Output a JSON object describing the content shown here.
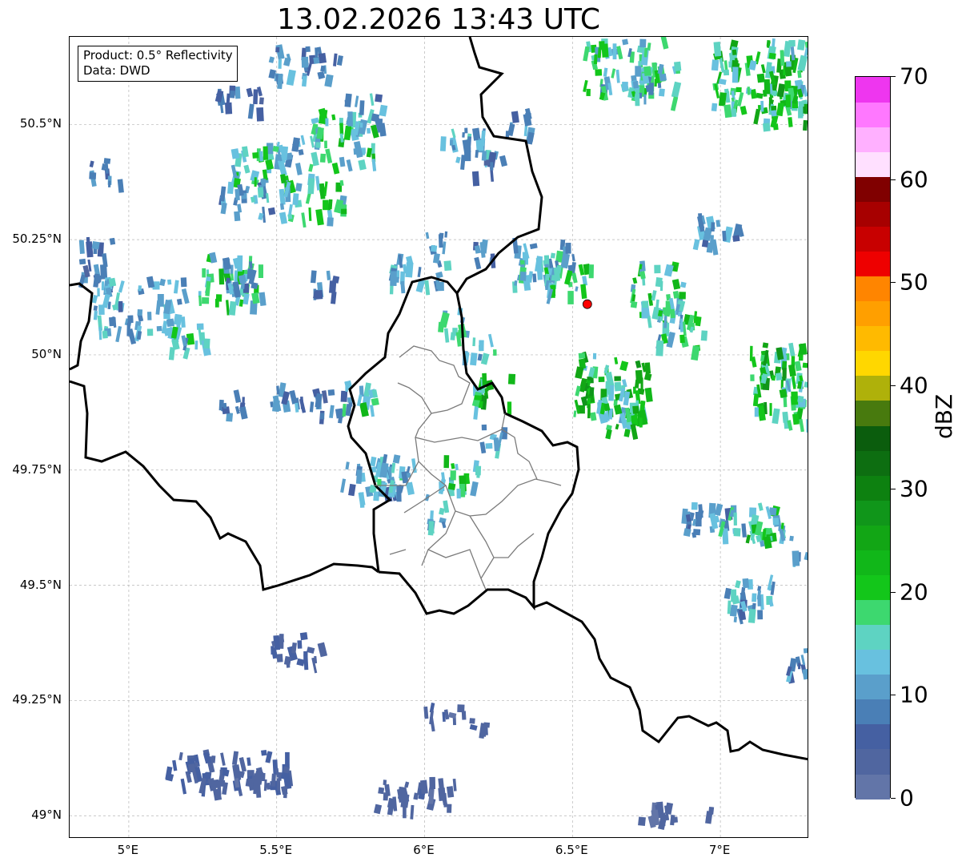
{
  "title": "13.02.2026 13:43 UTC",
  "info_box": {
    "product": "Product: 0.5° Reflectivity",
    "source": "Data: DWD"
  },
  "map": {
    "lon_range": [
      4.8,
      7.3
    ],
    "lat_range": [
      48.95,
      50.69
    ],
    "lat_ticks": [
      {
        "value": 50.5,
        "label": "50.5°N"
      },
      {
        "value": 50.25,
        "label": "50.25°N"
      },
      {
        "value": 50.0,
        "label": "50°N"
      },
      {
        "value": 49.75,
        "label": "49.75°N"
      },
      {
        "value": 49.5,
        "label": "49.5°N"
      },
      {
        "value": 49.25,
        "label": "49.25°N"
      },
      {
        "value": 49.0,
        "label": "49°N"
      }
    ],
    "lon_ticks": [
      {
        "value": 5.0,
        "label": "5°E"
      },
      {
        "value": 5.5,
        "label": "5.5°E"
      },
      {
        "value": 6.0,
        "label": "6°E"
      },
      {
        "value": 6.5,
        "label": "6.5°E"
      },
      {
        "value": 7.0,
        "label": "7°E"
      }
    ],
    "gridlines": true,
    "radar_site_marker": {
      "lon": 6.55,
      "lat": 50.11,
      "color": "#ff0000"
    }
  },
  "colorbar": {
    "unit": "dBZ",
    "min": 0,
    "max": 70,
    "tick_labels": [
      "0",
      "10",
      "20",
      "30",
      "40",
      "50",
      "60",
      "70"
    ],
    "colors": [
      "#6275a8",
      "#5066a0",
      "#4560a2",
      "#4a7fb6",
      "#5a9fcb",
      "#68c1df",
      "#5ed3c2",
      "#3dd86f",
      "#13c61a",
      "#11b719",
      "#12a615",
      "#10961a",
      "#0d8110",
      "#0d6e11",
      "#0b5d0d",
      "#487a0e",
      "#afb10a",
      "#ffd700",
      "#ffba00",
      "#ff9f00",
      "#ff8500",
      "#ee0000",
      "#c80000",
      "#a70000",
      "#800000",
      "#ffe0ff",
      "#ffb0ff",
      "#ff78ff",
      "#ee36ef"
    ]
  }
}
